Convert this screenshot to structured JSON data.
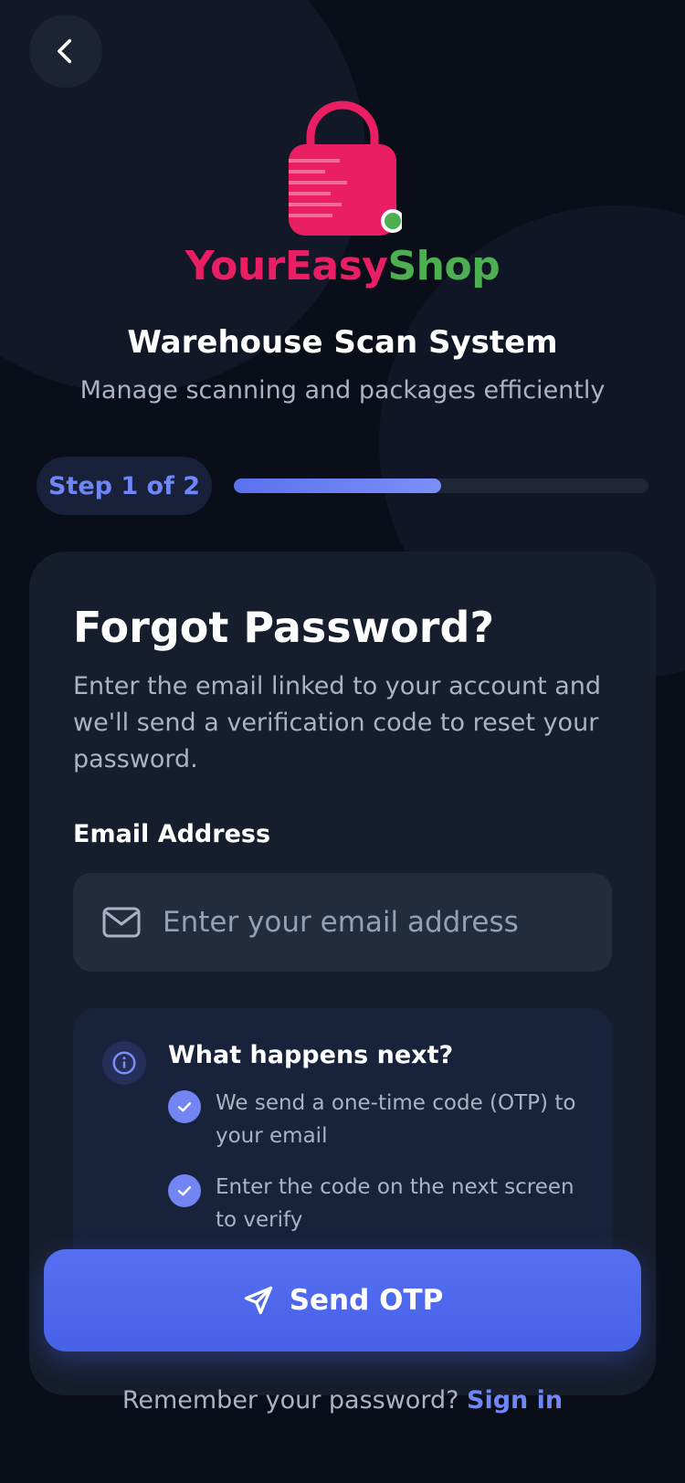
{
  "brand": {
    "part1": "Your",
    "part2": "Easy",
    "part3": "Shop",
    "color_primary": "#e91e63",
    "color_secondary": "#4caf50"
  },
  "header": {
    "title": "Warehouse Scan System",
    "subtitle": "Manage scanning and packages efficiently"
  },
  "progress": {
    "step_label": "Step 1 of 2",
    "fraction": 0.5
  },
  "card": {
    "title": "Forgot Password?",
    "description": "Enter the email linked to your account and we'll send a verification code to reset your password.",
    "email_label": "Email Address",
    "email_placeholder": "Enter your email address",
    "email_value": ""
  },
  "info": {
    "title": "What happens next?",
    "items": [
      "We send a one-time code (OTP) to your email",
      "Enter the code on the next screen to verify"
    ]
  },
  "actions": {
    "send_label": "Send OTP"
  },
  "footer": {
    "prompt": "Remember your password?",
    "link": "Sign in"
  },
  "icons": {
    "back": "chevron-left-icon",
    "logo": "lock-icon",
    "email": "mail-icon",
    "info": "info-icon",
    "check": "check-icon",
    "send": "send-icon"
  },
  "colors": {
    "accent": "#5a72ee",
    "background": "#0a0e18",
    "card": "#161d2c"
  }
}
